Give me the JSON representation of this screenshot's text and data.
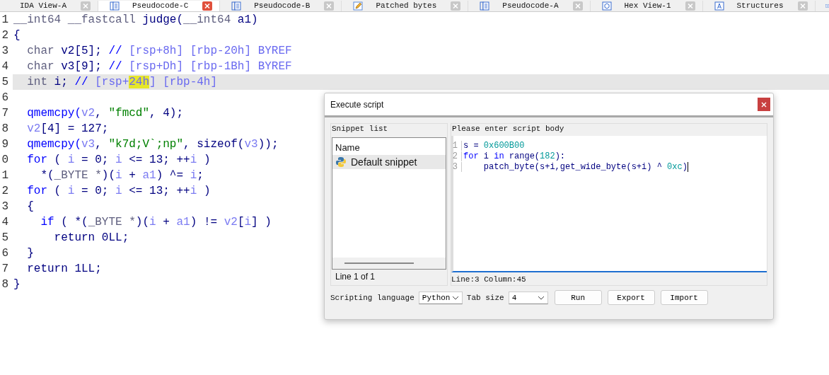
{
  "tabs": [
    {
      "label": "IDA View-A",
      "kind": "plain",
      "selected": false
    },
    {
      "label": "Pseudocode-C",
      "kind": "pseudocode",
      "selected": true
    },
    {
      "label": "Pseudocode-B",
      "kind": "pseudocode",
      "selected": false
    },
    {
      "label": "Patched bytes",
      "kind": "patch",
      "selected": false
    },
    {
      "label": "Pseudocode-A",
      "kind": "pseudocode",
      "selected": false
    },
    {
      "label": "Hex View-1",
      "kind": "hex",
      "selected": false
    },
    {
      "label": "Structures",
      "kind": "struct",
      "selected": false
    }
  ],
  "code": {
    "lines": [
      {
        "number": "1",
        "selected": false,
        "tokens": [
          {
            "kind": "type",
            "t": "__int64 __fastcall"
          },
          {
            "kind": "plain",
            "t": " judge("
          },
          {
            "kind": "type",
            "t": "__int64"
          },
          {
            "kind": "plain",
            "t": " a1)"
          }
        ]
      },
      {
        "number": "2",
        "selected": false,
        "tokens": [
          {
            "kind": "plain",
            "t": "{"
          }
        ]
      },
      {
        "number": "3",
        "selected": false,
        "tokens": [
          {
            "kind": "type",
            "t": "  char"
          },
          {
            "kind": "plain",
            "t": " v2[5]; "
          },
          {
            "kind": "func",
            "t": "//"
          },
          {
            "kind": "comment",
            "t": " [rsp+8h] [rbp-20h] BYREF"
          }
        ]
      },
      {
        "number": "4",
        "selected": false,
        "tokens": [
          {
            "kind": "type",
            "t": "  char"
          },
          {
            "kind": "plain",
            "t": " v3[9]; "
          },
          {
            "kind": "func",
            "t": "//"
          },
          {
            "kind": "comment",
            "t": " [rsp+Dh] [rbp-1Bh] BYREF"
          }
        ]
      },
      {
        "number": "5",
        "selected": true,
        "tokens": [
          {
            "kind": "type",
            "t": "  int"
          },
          {
            "kind": "plain",
            "t": " i; "
          },
          {
            "kind": "func",
            "t": "//"
          },
          {
            "kind": "comment",
            "t": " [rsp+"
          },
          {
            "kind": "highlight",
            "t": "24h"
          },
          {
            "kind": "comment",
            "t": "] [rbp-4h]"
          }
        ]
      },
      {
        "number": "6",
        "selected": false
      },
      {
        "number": "7",
        "selected": false,
        "tokens": [
          {
            "kind": "func",
            "t": "  qmemcpy("
          },
          {
            "kind": "var",
            "t": "v2"
          },
          {
            "kind": "plain",
            "t": ", "
          },
          {
            "kind": "string",
            "t": "\"fmcd\""
          },
          {
            "kind": "plain",
            "t": ", 4);"
          }
        ]
      },
      {
        "number": "8",
        "selected": false,
        "tokens": [
          {
            "kind": "var",
            "t": "  v2"
          },
          {
            "kind": "plain",
            "t": "[4] = 127;"
          }
        ]
      },
      {
        "number": "9",
        "selected": false,
        "tokens": [
          {
            "kind": "func",
            "t": "  qmemcpy("
          },
          {
            "kind": "var",
            "t": "v3"
          },
          {
            "kind": "plain",
            "t": ", "
          },
          {
            "kind": "string",
            "t": "\"k7d;V`;np\""
          },
          {
            "kind": "plain",
            "t": ", sizeof("
          },
          {
            "kind": "var",
            "t": "v3"
          },
          {
            "kind": "plain",
            "t": "));"
          }
        ]
      },
      {
        "number": "0",
        "selected": false,
        "tokens": [
          {
            "kind": "func",
            "t": "  for"
          },
          {
            "kind": "plain",
            "t": " ( "
          },
          {
            "kind": "var",
            "t": "i"
          },
          {
            "kind": "plain",
            "t": " = 0; "
          },
          {
            "kind": "var",
            "t": "i"
          },
          {
            "kind": "plain",
            "t": " <= 13; ++"
          },
          {
            "kind": "var",
            "t": "i"
          },
          {
            "kind": "plain",
            "t": " )"
          }
        ]
      },
      {
        "number": "1",
        "selected": false,
        "tokens": [
          {
            "kind": "plain",
            "t": "    *("
          },
          {
            "kind": "type",
            "t": "_BYTE *"
          },
          {
            "kind": "plain",
            "t": ")("
          },
          {
            "kind": "var",
            "t": "i"
          },
          {
            "kind": "plain",
            "t": " + "
          },
          {
            "kind": "var",
            "t": "a1"
          },
          {
            "kind": "plain",
            "t": ") ^= "
          },
          {
            "kind": "var",
            "t": "i"
          },
          {
            "kind": "plain",
            "t": ";"
          }
        ]
      },
      {
        "number": "2",
        "selected": false,
        "tokens": [
          {
            "kind": "func",
            "t": "  for"
          },
          {
            "kind": "plain",
            "t": " ( "
          },
          {
            "kind": "var",
            "t": "i"
          },
          {
            "kind": "plain",
            "t": " = 0; "
          },
          {
            "kind": "var",
            "t": "i"
          },
          {
            "kind": "plain",
            "t": " <= 13; ++"
          },
          {
            "kind": "var",
            "t": "i"
          },
          {
            "kind": "plain",
            "t": " )"
          }
        ]
      },
      {
        "number": "3",
        "selected": false,
        "tokens": [
          {
            "kind": "plain",
            "t": "  {"
          }
        ]
      },
      {
        "number": "4",
        "selected": false,
        "tokens": [
          {
            "kind": "func",
            "t": "    if"
          },
          {
            "kind": "plain",
            "t": " ( *("
          },
          {
            "kind": "type",
            "t": "_BYTE *"
          },
          {
            "kind": "plain",
            "t": ")("
          },
          {
            "kind": "var",
            "t": "i"
          },
          {
            "kind": "plain",
            "t": " + "
          },
          {
            "kind": "var",
            "t": "a1"
          },
          {
            "kind": "plain",
            "t": ") != "
          },
          {
            "kind": "var",
            "t": "v2"
          },
          {
            "kind": "plain",
            "t": "["
          },
          {
            "kind": "var",
            "t": "i"
          },
          {
            "kind": "plain",
            "t": "] )"
          }
        ]
      },
      {
        "number": "5",
        "selected": false,
        "tokens": [
          {
            "kind": "plain",
            "t": "      return 0LL;"
          }
        ]
      },
      {
        "number": "6",
        "selected": false,
        "tokens": [
          {
            "kind": "plain",
            "t": "  }"
          }
        ]
      },
      {
        "number": "7",
        "selected": false,
        "tokens": [
          {
            "kind": "plain",
            "t": "  return 1LL;"
          }
        ]
      },
      {
        "number": "8",
        "selected": false,
        "tokens": [
          {
            "kind": "plain",
            "t": "}"
          }
        ]
      }
    ]
  },
  "dialog": {
    "title": "Execute script",
    "snippet_list": {
      "label": "Snippet list",
      "header": "Name",
      "items": [
        {
          "name": "Default snippet",
          "selected": true
        }
      ],
      "status": "Line 1 of 1"
    },
    "script": {
      "label": "Please enter script body",
      "lines": [
        {
          "number": "1",
          "tokens": [
            {
              "kind": "plain",
              "t": "s = "
            },
            {
              "kind": "number",
              "t": "0x600B00"
            }
          ]
        },
        {
          "number": "2",
          "tokens": [
            {
              "kind": "keyword",
              "t": "for"
            },
            {
              "kind": "plain",
              "t": " i "
            },
            {
              "kind": "keyword",
              "t": "in"
            },
            {
              "kind": "plain",
              "t": " range("
            },
            {
              "kind": "number",
              "t": "182"
            },
            {
              "kind": "plain",
              "t": "):"
            }
          ]
        },
        {
          "number": "3",
          "tokens": [
            {
              "kind": "plain",
              "t": "    patch_byte(s+i,get_wide_byte(s+i) ^ "
            },
            {
              "kind": "number",
              "t": "0xc"
            },
            {
              "kind": "plain",
              "t": ")"
            }
          ]
        }
      ],
      "status": "Line:3  Column:45"
    },
    "language_label": "Scripting language",
    "language": "Python",
    "tab_size_label": "Tab size",
    "tab_size": "4",
    "buttons": [
      "Run",
      "Export",
      "Import"
    ]
  }
}
